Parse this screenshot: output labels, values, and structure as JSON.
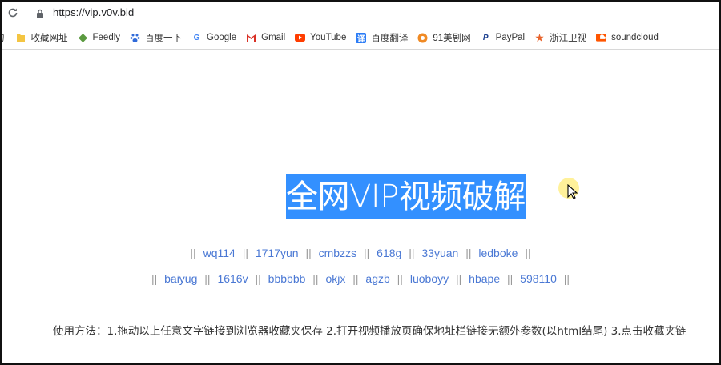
{
  "browser": {
    "url": "https://vip.v0v.bid"
  },
  "bookmarks": [
    {
      "label": "的",
      "icon": "truncated"
    },
    {
      "label": "收藏网址",
      "icon": "folder-icon",
      "color": "#f4c542"
    },
    {
      "label": "Feedly",
      "icon": "feedly-icon",
      "color": "#5b9a3f"
    },
    {
      "label": "百度一下",
      "icon": "baidu-icon",
      "color": "#2f6ad9"
    },
    {
      "label": "Google",
      "icon": "google-icon",
      "color": "#4285f4"
    },
    {
      "label": "Gmail",
      "icon": "gmail-icon",
      "color": "#d93025"
    },
    {
      "label": "YouTube",
      "icon": "youtube-icon",
      "color": "#ff3d00"
    },
    {
      "label": "百度翻译",
      "icon": "baidu-translate-icon",
      "color": "#2b7cf6"
    },
    {
      "label": "91美剧网",
      "icon": "meiju-icon",
      "color": "#f08a24"
    },
    {
      "label": "PayPal",
      "icon": "paypal-icon",
      "color": "#1b3f8f"
    },
    {
      "label": "浙江卫视",
      "icon": "zhejiang-tv-icon",
      "color": "#e8632b"
    },
    {
      "label": "soundcloud",
      "icon": "soundcloud-icon",
      "color": "#ff5500"
    }
  ],
  "page": {
    "title": "全网VIP视频破解",
    "separator": "||",
    "links_row1": [
      "wq114",
      "1717yun",
      "cmbzzs",
      "618g",
      "33yuan",
      "ledboke"
    ],
    "links_row2": [
      "baiyug",
      "1616v",
      "bbbbbb",
      "okjx",
      "agzb",
      "luoboyy",
      "hbape",
      "598110"
    ],
    "instructions": "使用方法：1.拖动以上任意文字链接到浏览器收藏夹保存 2.打开视频播放页确保地址栏链接无额外参数(以html结尾) 3.点击收藏夹链"
  },
  "colors": {
    "title_highlight": "#3390ff",
    "link": "#4a78d4",
    "separator": "#9a9a9a"
  }
}
